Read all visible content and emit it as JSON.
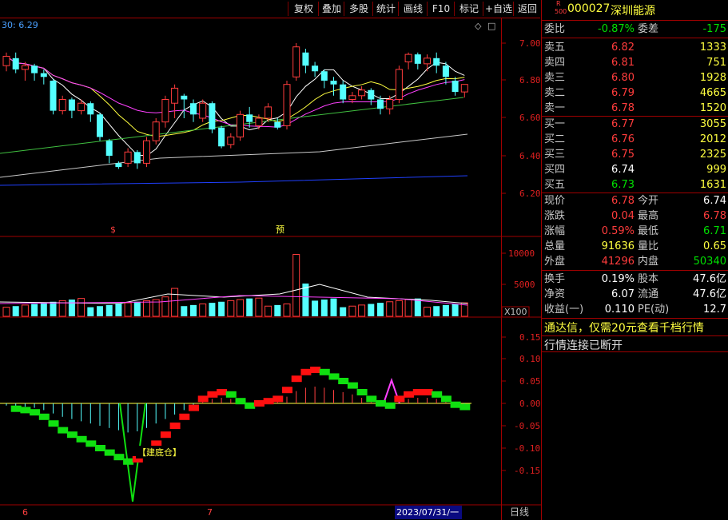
{
  "toolbar": {
    "buttons": [
      "复权",
      "叠加",
      "多股",
      "统计",
      "画线",
      "F10",
      "标记",
      "+自选",
      "返回"
    ]
  },
  "main_chart": {
    "ma_label": "30: 6.29",
    "price_ticks": [
      "7.00",
      "6.80",
      "6.60",
      "6.40",
      "6.20"
    ],
    "markers": [
      "$",
      "预"
    ],
    "diamond_icon": "◇",
    "square_icon": "□"
  },
  "volume_chart": {
    "ticks": [
      "10000",
      "5000"
    ],
    "unit_label": "X100"
  },
  "macd_chart": {
    "ticks": [
      "0.15",
      "0.10",
      "0.05",
      "0.00",
      "-0.05",
      "-0.10",
      "-0.15"
    ],
    "annotation": "建底仓"
  },
  "bottom_axis": {
    "month_labels": [
      "6",
      "7"
    ],
    "date_cursor": "2023/07/31/一",
    "period": "日线"
  },
  "stock": {
    "r_badge": "R",
    "r_badge_sub": "500",
    "code": "000027",
    "name": "深圳能源",
    "webi_label": "委比",
    "webi": "-0.87%",
    "weicha_label": "委差",
    "weicha": "-175",
    "asks": [
      {
        "label": "卖五",
        "price": "6.82",
        "vol": "1333"
      },
      {
        "label": "卖四",
        "price": "6.81",
        "vol": "751"
      },
      {
        "label": "卖三",
        "price": "6.80",
        "vol": "1928"
      },
      {
        "label": "卖二",
        "price": "6.79",
        "vol": "4665"
      },
      {
        "label": "卖一",
        "price": "6.78",
        "vol": "1520"
      }
    ],
    "bids": [
      {
        "label": "买一",
        "price": "6.77",
        "vol": "3055"
      },
      {
        "label": "买二",
        "price": "6.76",
        "vol": "2012"
      },
      {
        "label": "买三",
        "price": "6.75",
        "vol": "2325"
      },
      {
        "label": "买四",
        "price": "6.74",
        "vol": "999"
      },
      {
        "label": "买五",
        "price": "6.73",
        "vol": "1631"
      }
    ],
    "stats1": [
      {
        "l1": "现价",
        "v1": "6.78",
        "l2": "今开",
        "v2": "6.74"
      },
      {
        "l1": "涨跌",
        "v1": "0.04",
        "l2": "最高",
        "v2": "6.78"
      },
      {
        "l1": "涨幅",
        "v1": "0.59%",
        "l2": "最低",
        "v2": "6.71"
      },
      {
        "l1": "总量",
        "v1": "91636",
        "l2": "量比",
        "v2": "0.65"
      },
      {
        "l1": "外盘",
        "v1": "41296",
        "l2": "内盘",
        "v2": "50340"
      }
    ],
    "stats2": [
      {
        "l1": "换手",
        "v1": "0.19%",
        "l2": "股本",
        "v2": "47.6亿"
      },
      {
        "l1": "净资",
        "v1": "6.07",
        "l2": "流通",
        "v2": "47.6亿"
      },
      {
        "l1": "收益(一)",
        "v1": "0.110",
        "l2": "PE(动)",
        "v2": "12.7"
      }
    ],
    "promo": "通达信，仅需20元查看千档行情",
    "status": "行情连接已断开"
  },
  "colors": {
    "up": "#ff3c3c",
    "down": "#54ffff",
    "grid": "#a00000"
  }
}
